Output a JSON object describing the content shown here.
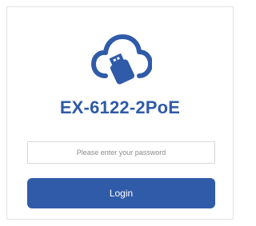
{
  "brand": {
    "logo_icon": "cloud-usb-icon",
    "device_name": "EX-6122-2PoE"
  },
  "login_form": {
    "password_placeholder": "Please enter your password",
    "password_value": "",
    "login_label": "Login"
  },
  "colors": {
    "accent": "#2f5ba8",
    "background": "#ffffff",
    "input_border": "#d6d6d6"
  }
}
